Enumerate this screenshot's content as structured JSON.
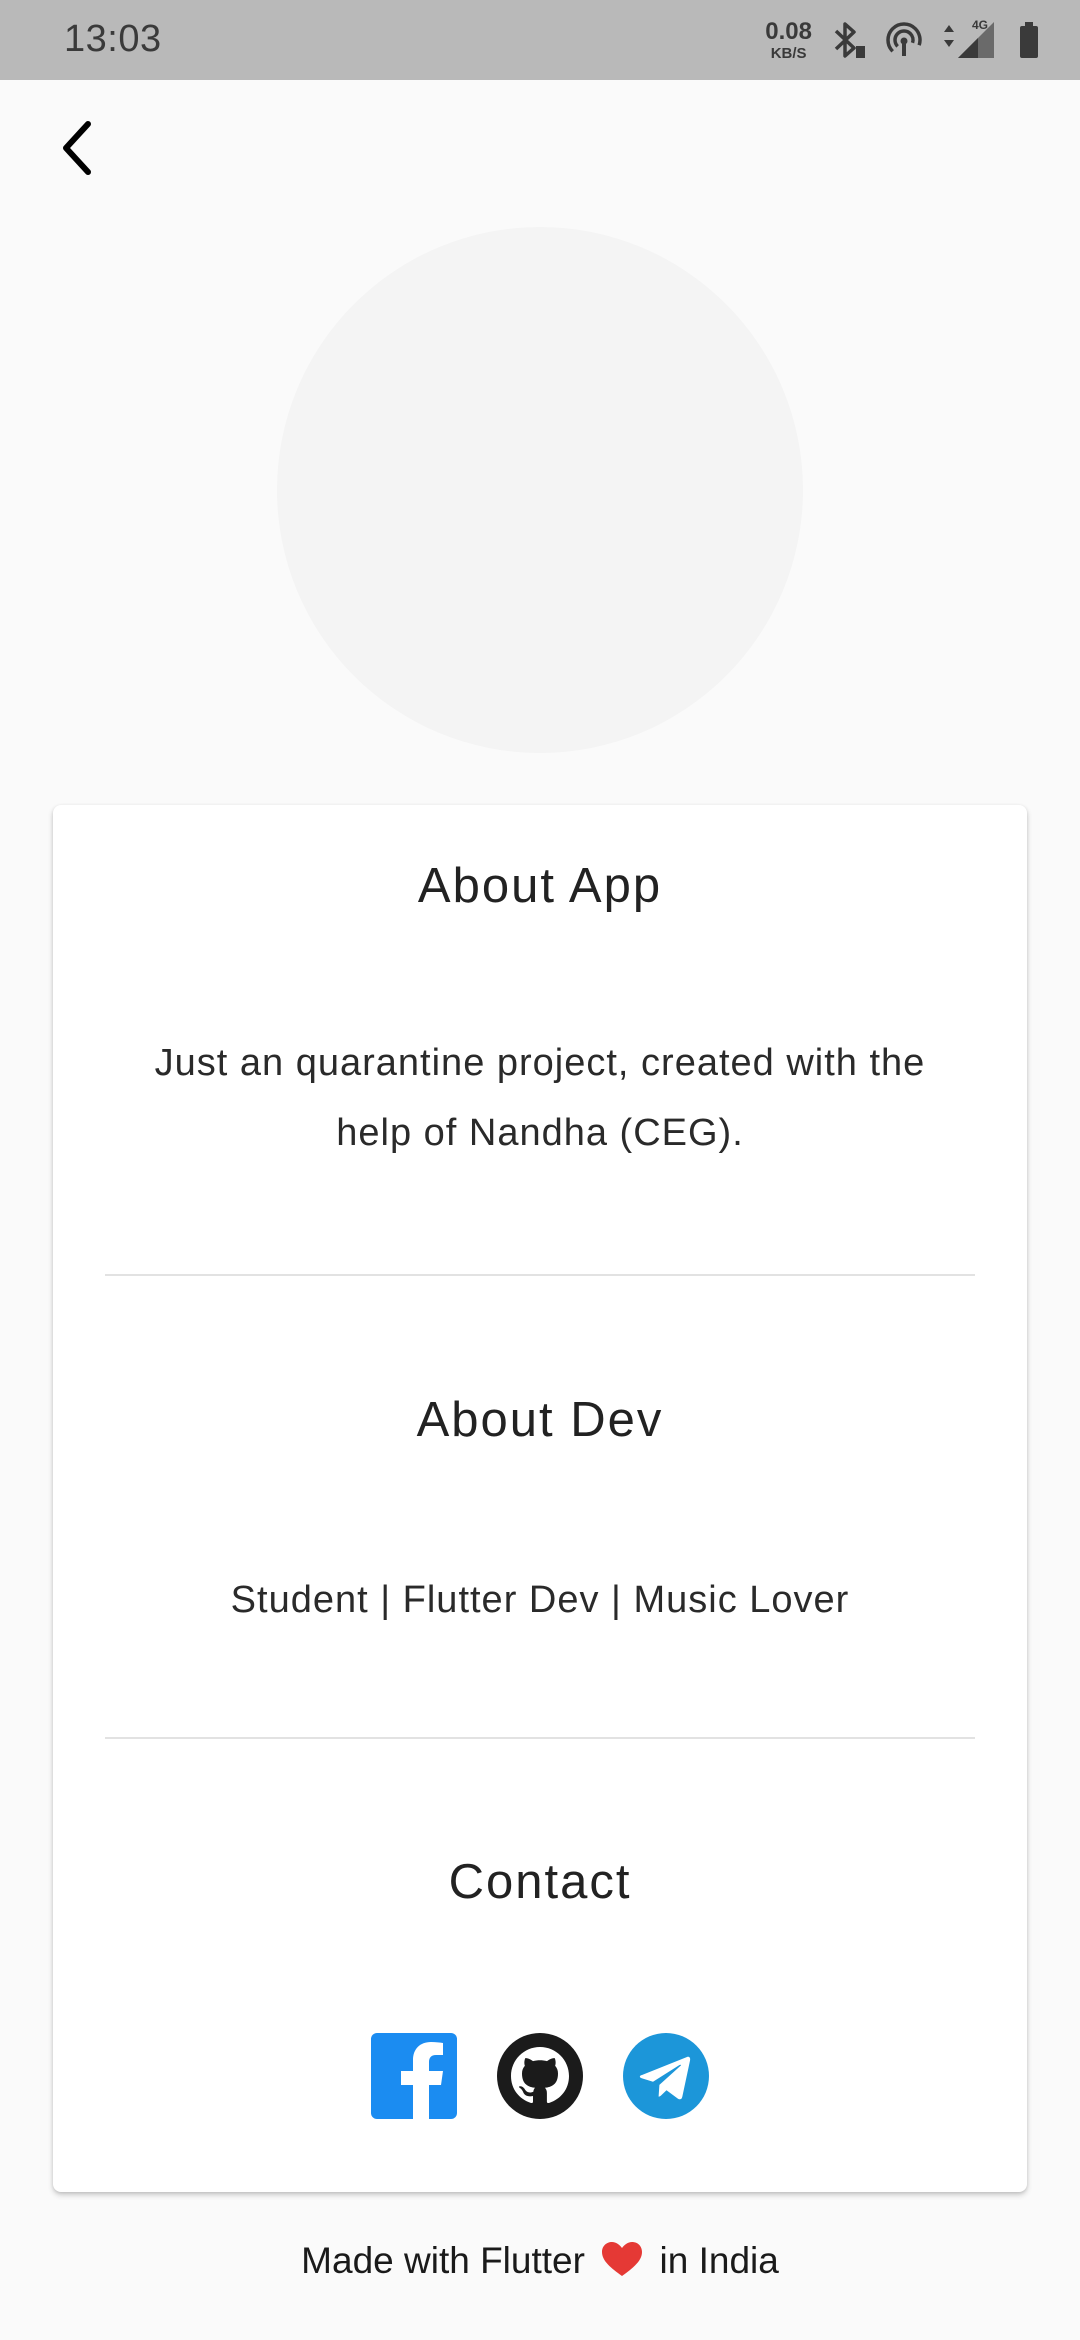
{
  "status_bar": {
    "time": "13:03",
    "speed_value": "0.08",
    "speed_unit": "KB/S",
    "network_label": "4G",
    "icons": [
      "bluetooth-icon",
      "hotspot-icon",
      "data-arrows-icon",
      "signal-icon",
      "battery-icon"
    ]
  },
  "nav": {
    "back_icon": "back-arrow-icon"
  },
  "sections": {
    "about_app": {
      "title": "About App",
      "body": "Just an quarantine project, created with the help of Nandha (CEG)."
    },
    "about_dev": {
      "title": "About Dev",
      "body": "Student | Flutter Dev | Music Lover"
    },
    "contact": {
      "title": "Contact",
      "icons": [
        "facebook-icon",
        "github-icon",
        "telegram-icon"
      ]
    }
  },
  "footer": {
    "prefix": "Made with Flutter",
    "heart_icon": "heart-icon",
    "suffix": "in India"
  },
  "colors": {
    "status_bar_bg": "#b9b9b9",
    "page_bg": "#fafafa",
    "card_bg": "#ffffff",
    "avatar_bg": "#f4f4f4",
    "facebook": "#1b8cf1",
    "telegram": "#1c96d9",
    "github": "#1b1b1b",
    "heart": "#e53935"
  }
}
